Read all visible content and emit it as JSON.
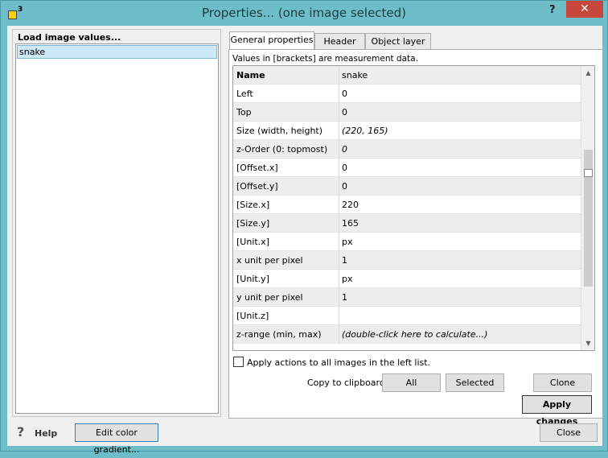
{
  "window": {
    "title": "Properties... (one image selected)",
    "help_glyph": "?",
    "close_glyph": "✕",
    "app_icon_sup": "3"
  },
  "left": {
    "group_title": "Load image values...",
    "items": [
      "snake"
    ]
  },
  "tabs": [
    {
      "label": "General properties",
      "active": true
    },
    {
      "label": "Header",
      "active": false
    },
    {
      "label": "Object layer",
      "active": false
    }
  ],
  "info_text": "Values in [brackets] are measurement data.",
  "grid": {
    "rows": [
      {
        "key": "Name",
        "value": "snake"
      },
      {
        "key": "Left",
        "value": "0"
      },
      {
        "key": "Top",
        "value": "0"
      },
      {
        "key": "Size (width, height)",
        "value": "(220, 165)"
      },
      {
        "key": "z-Order (0: topmost)",
        "value": "0"
      },
      {
        "key": "[Offset.x]",
        "value": "0"
      },
      {
        "key": "[Offset.y]",
        "value": "0"
      },
      {
        "key": "[Size.x]",
        "value": "220"
      },
      {
        "key": "[Size.y]",
        "value": "165"
      },
      {
        "key": "[Unit.x]",
        "value": "px"
      },
      {
        "key": "x unit per pixel",
        "value": "1"
      },
      {
        "key": "[Unit.y]",
        "value": "px"
      },
      {
        "key": "y unit per pixel",
        "value": "1"
      },
      {
        "key": "[Unit.z]",
        "value": ""
      },
      {
        "key": "z-range (min, max)",
        "value": "(double-click here to calculate...)"
      }
    ]
  },
  "apply_all_label": "Apply actions to all images in the left list.",
  "clipboard": {
    "label": "Copy to clipboard:",
    "all": "All",
    "selected": "Selected"
  },
  "buttons": {
    "clone": "Clone",
    "apply_changes": "Apply changes",
    "help": "Help",
    "edit_gradient": "Edit color gradient...",
    "close": "Close"
  }
}
